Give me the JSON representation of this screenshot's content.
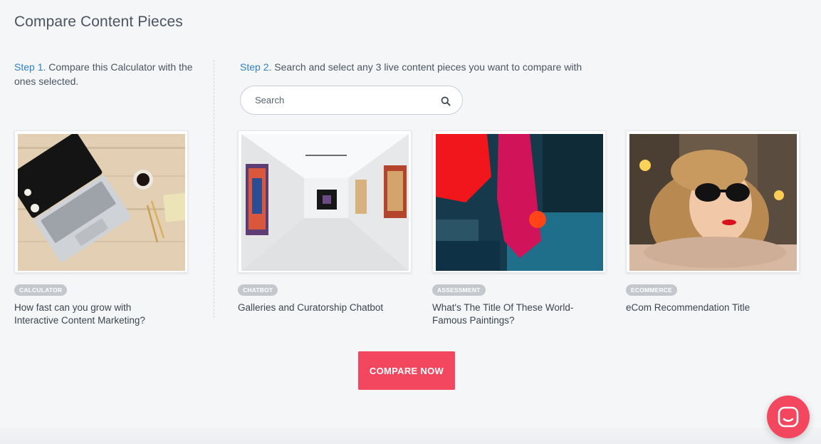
{
  "page": {
    "title": "Compare Content Pieces"
  },
  "step1": {
    "label": "Step 1.",
    "text": " Compare this Calculator with the ones selected."
  },
  "step2": {
    "label": "Step 2.",
    "text": " Search and select any 3 live content pieces you want to compare with"
  },
  "search": {
    "placeholder": "Search",
    "icon": "search-icon"
  },
  "selected_piece": {
    "badge": "CALCULATOR",
    "title": "How fast can you grow with Interactive Content Marketing?",
    "image": "laptop-on-desk-image"
  },
  "compare_pieces": [
    {
      "badge": "CHATBOT",
      "title": "Galleries and Curatorship Chatbot",
      "image": "art-gallery-image"
    },
    {
      "badge": "ASSESSMENT",
      "title": "What's The Title Of These World-Famous Paintings?",
      "image": "abstract-painting-image"
    },
    {
      "badge": "ECOMMERCE",
      "title": "eCom Recommendation Title",
      "image": "woman-sunglasses-image"
    }
  ],
  "actions": {
    "compare_label": "COMPARE NOW"
  },
  "chat": {
    "icon": "chat-icon"
  },
  "colors": {
    "background": "#f5f6f8",
    "accent": "#f2475e",
    "step_label": "#2f80c8",
    "badge": "#c4c8cd",
    "text": "#3b4450"
  }
}
